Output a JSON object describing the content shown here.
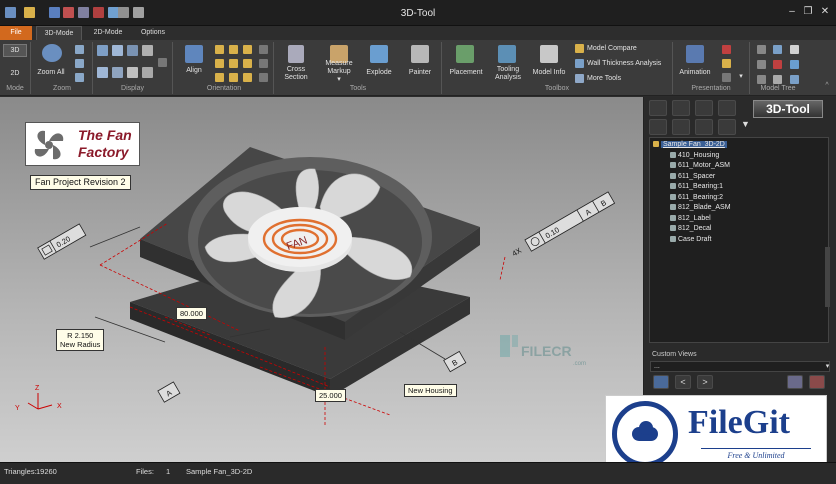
{
  "window": {
    "title": "3D-Tool"
  },
  "tabs": [
    "File",
    "3D-Mode",
    "2D-Mode",
    "Options"
  ],
  "ribbon": {
    "mode": {
      "btn_3d": "3D",
      "btn_2d": "2D",
      "group": "Mode"
    },
    "zoom": {
      "zoom_all": "Zoom All",
      "group": "Zoom"
    },
    "display": {
      "group": "Display"
    },
    "orientation": {
      "align": "Align",
      "group": "Orientation"
    },
    "tools": {
      "cross_section": [
        "Cross",
        "Section"
      ],
      "measure_markup": [
        "Measure",
        "Markup"
      ],
      "explode": "Explode",
      "painter": "Painter",
      "group": "Tools"
    },
    "toolbox": {
      "placement": "Placement",
      "tooling_analysis": [
        "Tooling",
        "Analysis"
      ],
      "model_info": "Model Info",
      "model_compare": "Model Compare",
      "wall_thickness": "Wall Thickness Analysis",
      "more_tools": "More Tools",
      "group": "Toolbox"
    },
    "presentation": {
      "animation": "Animation",
      "group": "Presentation"
    },
    "model_tree": {
      "group": "Model Tree"
    }
  },
  "viewport": {
    "logo": [
      "The Fan",
      "Factory"
    ],
    "project_label": "Fan Project Revision 2",
    "fan_text": "FAN",
    "annotations": {
      "tol_left": "0.20",
      "multiplier": "4X",
      "tol_right": "0.10",
      "datum_a": "A",
      "datum_b": "B",
      "radius": "R 2.150",
      "radius_note": "New Radius",
      "dim_80": "80.000",
      "dim_25": "25.000",
      "new_housing": "New Housing",
      "datum_a_bottom": "A",
      "datum_b_bottom": "B"
    },
    "watermark": "FILECR",
    "watermark_sub": ".com",
    "axes": {
      "x": "X",
      "y": "Y",
      "z": "Z"
    }
  },
  "panel": {
    "brand": "3D-Tool",
    "tree": [
      {
        "label": "Sample Fan_3D-2D",
        "level": 0,
        "selected": true
      },
      {
        "label": "410_Housing",
        "level": 1
      },
      {
        "label": "611_Motor_ASM",
        "level": 1
      },
      {
        "label": "611_Spacer",
        "level": 1
      },
      {
        "label": "611_Bearing:1",
        "level": 1
      },
      {
        "label": "611_Bearing:2",
        "level": 1
      },
      {
        "label": "812_Blade_ASM",
        "level": 1
      },
      {
        "label": "812_Label",
        "level": 1
      },
      {
        "label": "812_Decal",
        "level": 1
      },
      {
        "label": "Case Draft",
        "level": 1
      }
    ],
    "custom_views": {
      "label": "Custom Views",
      "value": "..."
    }
  },
  "status": {
    "triangles_label": "Triangles:",
    "triangles_value": "19260",
    "files_label": "Files:",
    "files_value": "1",
    "file_name": "Sample Fan_3D-2D"
  },
  "overlay": {
    "brand": "FileGit",
    "tagline": "Free & Unlimited"
  },
  "colors": {
    "accent": "#d2691e",
    "ribbon": "#3b3b3b",
    "dimension": "#cc0000",
    "filegit_blue": "#1c3f8c"
  }
}
